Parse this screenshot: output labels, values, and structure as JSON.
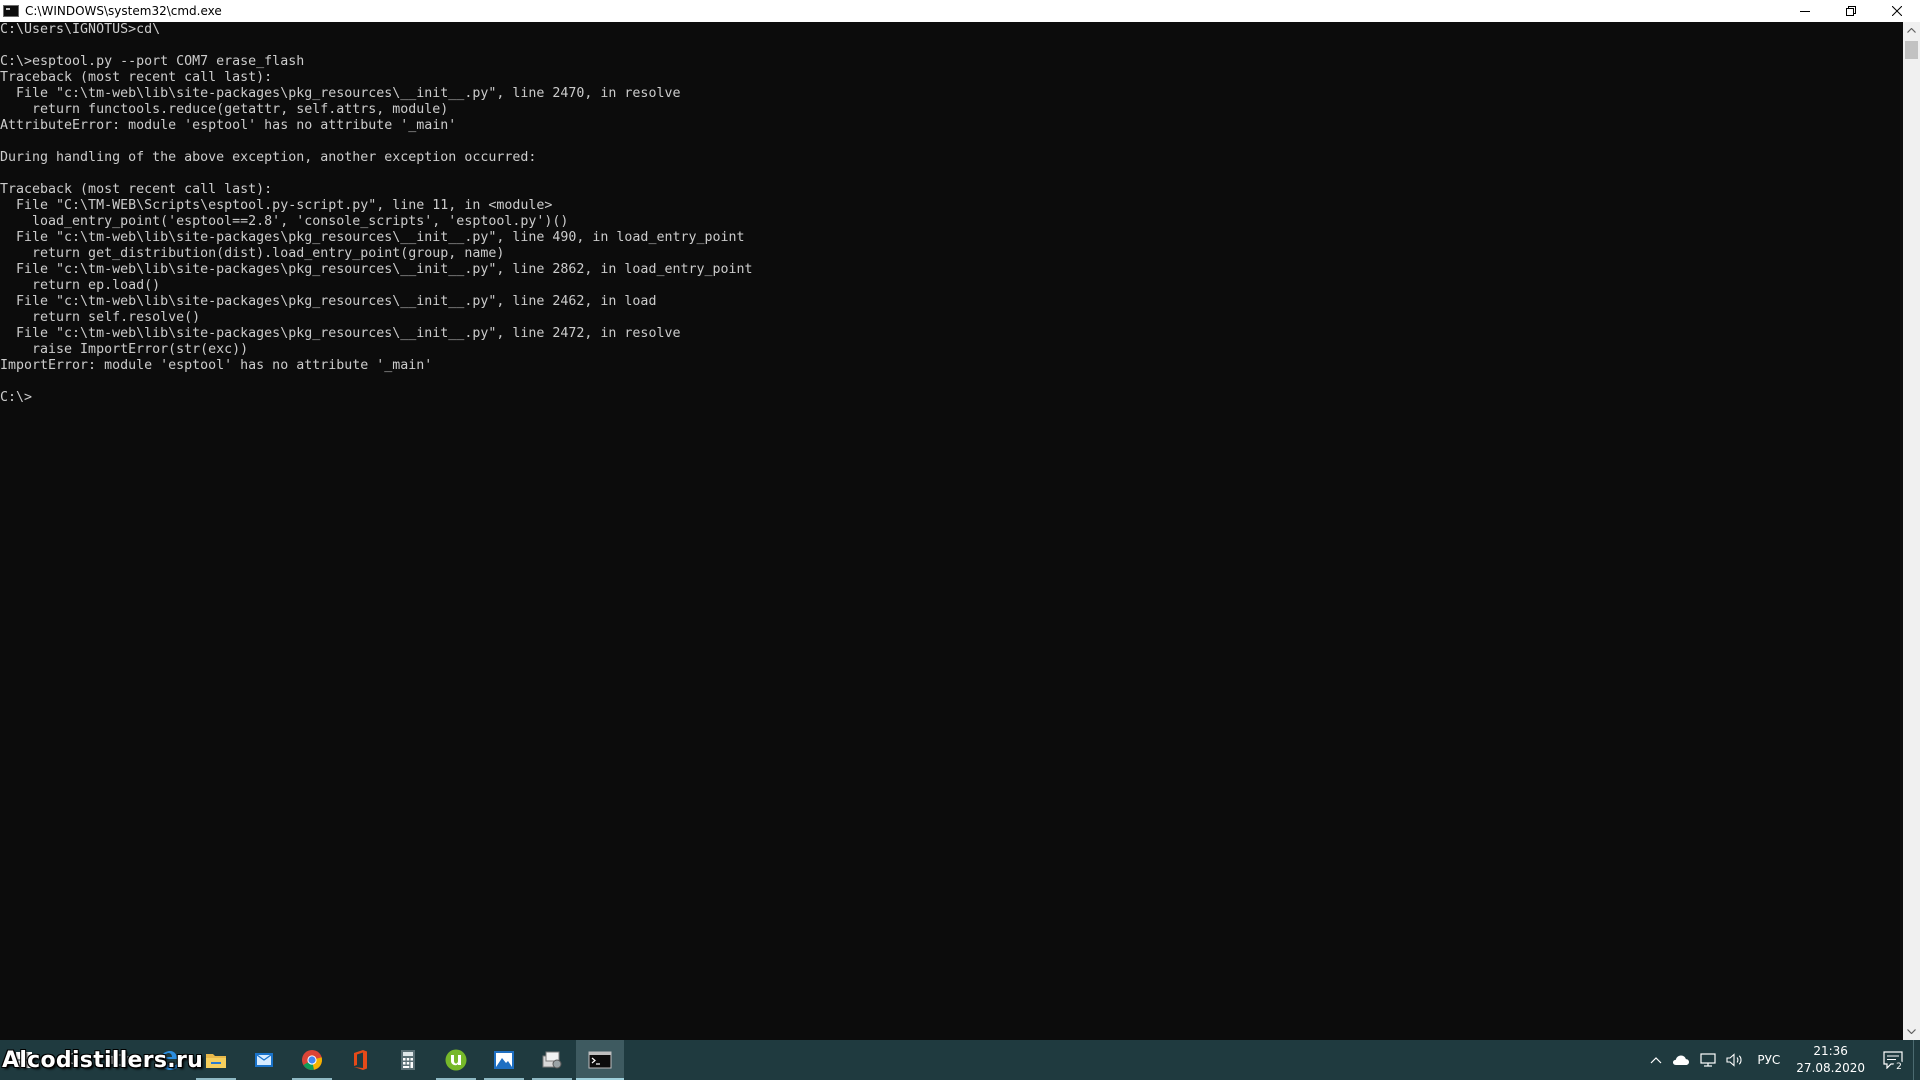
{
  "window": {
    "title": "C:\\WINDOWS\\system32\\cmd.exe"
  },
  "console": {
    "lines": [
      "C:\\Users\\IGNOTUS>cd\\",
      "",
      "C:\\>esptool.py --port COM7 erase_flash",
      "Traceback (most recent call last):",
      "  File \"c:\\tm-web\\lib\\site-packages\\pkg_resources\\__init__.py\", line 2470, in resolve",
      "    return functools.reduce(getattr, self.attrs, module)",
      "AttributeError: module 'esptool' has no attribute '_main'",
      "",
      "During handling of the above exception, another exception occurred:",
      "",
      "Traceback (most recent call last):",
      "  File \"C:\\TM-WEB\\Scripts\\esptool.py-script.py\", line 11, in <module>",
      "    load_entry_point('esptool==2.8', 'console_scripts', 'esptool.py')()",
      "  File \"c:\\tm-web\\lib\\site-packages\\pkg_resources\\__init__.py\", line 490, in load_entry_point",
      "    return get_distribution(dist).load_entry_point(group, name)",
      "  File \"c:\\tm-web\\lib\\site-packages\\pkg_resources\\__init__.py\", line 2862, in load_entry_point",
      "    return ep.load()",
      "  File \"c:\\tm-web\\lib\\site-packages\\pkg_resources\\__init__.py\", line 2462, in load",
      "    return self.resolve()",
      "  File \"c:\\tm-web\\lib\\site-packages\\pkg_resources\\__init__.py\", line 2472, in resolve",
      "    raise ImportError(str(exc))",
      "ImportError: module 'esptool' has no attribute '_main'",
      "",
      "C:\\>"
    ]
  },
  "taskbar": {
    "watermark": "Alcodistillers.ru",
    "apps": [
      {
        "icon": "edge-icon",
        "running": false,
        "active": false
      },
      {
        "icon": "file-explorer-icon",
        "running": true,
        "active": false
      },
      {
        "icon": "outlook-icon",
        "running": false,
        "active": false
      },
      {
        "icon": "chrome-icon",
        "running": true,
        "active": false
      },
      {
        "icon": "office-icon",
        "running": false,
        "active": false
      },
      {
        "icon": "calculator-icon",
        "running": false,
        "active": false
      },
      {
        "icon": "utorrent-icon",
        "running": true,
        "active": false
      },
      {
        "icon": "photos-icon",
        "running": true,
        "active": false
      },
      {
        "icon": "tool-app-icon",
        "running": true,
        "active": false
      },
      {
        "icon": "cmd-icon",
        "running": true,
        "active": true
      }
    ],
    "tray": {
      "language": "РУС",
      "time": "21:36",
      "date": "27.08.2020",
      "notification_count": "2"
    }
  },
  "colors": {
    "console_bg": "#0c0c0c",
    "console_text": "#cccccc",
    "taskbar_bg": "#1f3a3f",
    "titlebar_bg": "#ffffff"
  }
}
